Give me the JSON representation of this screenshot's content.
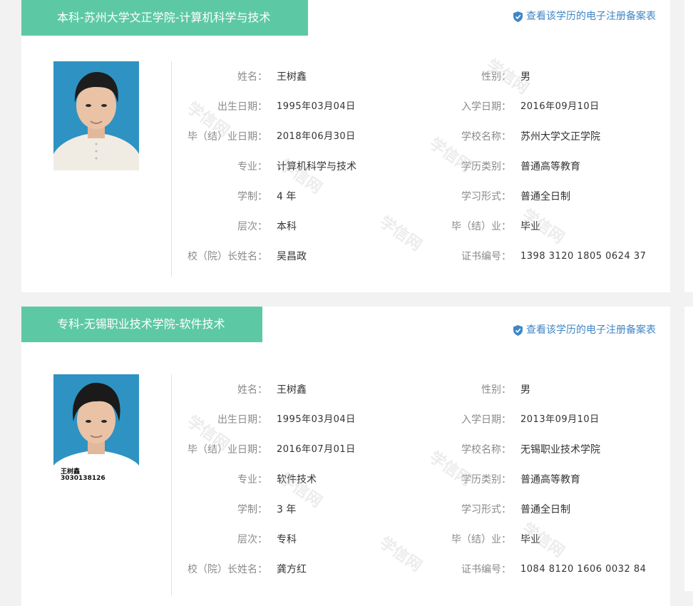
{
  "records": [
    {
      "banner": "本科-苏州大学文正学院-计算机科学与技术",
      "verify_link": "查看该学历的电子注册备案表",
      "fields_left": [
        {
          "label": "姓名：",
          "value": "王树鑫"
        },
        {
          "label": "出生日期：",
          "value": "1995年03月04日"
        },
        {
          "label": "毕（结）业日期：",
          "value": "2018年06月30日"
        },
        {
          "label": "专业：",
          "value": "计算机科学与技术"
        },
        {
          "label": "学制：",
          "value": "4 年"
        },
        {
          "label": "层次：",
          "value": "本科"
        },
        {
          "label": "校（院）长姓名：",
          "value": "吴昌政"
        }
      ],
      "fields_right": [
        {
          "label": "性别：",
          "value": "男"
        },
        {
          "label": "入学日期：",
          "value": "2016年09月10日"
        },
        {
          "label": "学校名称：",
          "value": "苏州大学文正学院"
        },
        {
          "label": "学历类别：",
          "value": "普通高等教育"
        },
        {
          "label": "学习形式：",
          "value": "普通全日制"
        },
        {
          "label": "毕（结）业：",
          "value": "毕业"
        },
        {
          "label": "证书编号：",
          "value": "1398 3120 1805 0624 37"
        }
      ]
    },
    {
      "banner": "专科-无锡职业技术学院-软件技术",
      "verify_link": "查看该学历的电子注册备案表",
      "photo_caption_name": "王树鑫",
      "photo_caption_id": "3030138126",
      "fields_left": [
        {
          "label": "姓名：",
          "value": "王树鑫"
        },
        {
          "label": "出生日期：",
          "value": "1995年03月04日"
        },
        {
          "label": "毕（结）业日期：",
          "value": "2016年07月01日"
        },
        {
          "label": "专业：",
          "value": "软件技术"
        },
        {
          "label": "学制：",
          "value": "3 年"
        },
        {
          "label": "层次：",
          "value": "专科"
        },
        {
          "label": "校（院）长姓名：",
          "value": "龚方红"
        }
      ],
      "fields_right": [
        {
          "label": "性别：",
          "value": "男"
        },
        {
          "label": "入学日期：",
          "value": "2013年09月10日"
        },
        {
          "label": "学校名称：",
          "value": "无锡职业技术学院"
        },
        {
          "label": "学历类别：",
          "value": "普通高等教育"
        },
        {
          "label": "学习形式：",
          "value": "普通全日制"
        },
        {
          "label": "毕（结）业：",
          "value": "毕业"
        },
        {
          "label": "证书编号：",
          "value": "1084 8120 1606 0032 84"
        }
      ]
    }
  ],
  "watermark_text": "学信网",
  "colors": {
    "banner_bg": "#5dc9a4",
    "link": "#3f86c6",
    "photo_bg": "#2e93c2",
    "label": "#8a8a8a",
    "value": "#333333"
  }
}
